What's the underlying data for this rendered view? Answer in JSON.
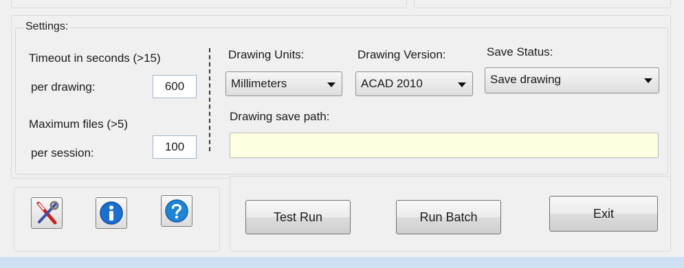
{
  "settings": {
    "group_title": "Settings:",
    "timeout_label": "Timeout in seconds (>15)",
    "per_drawing_label": "per drawing:",
    "timeout_value": "600",
    "max_files_label": "Maximum files (>5)",
    "per_session_label": "per session:",
    "max_files_value": "100",
    "units_label": "Drawing Units:",
    "units_value": "Millimeters",
    "version_label": "Drawing Version:",
    "version_value": "ACAD 2010",
    "save_status_label": "Save Status:",
    "save_status_value": "Save drawing",
    "save_path_label": "Drawing save path:",
    "save_path_value": ""
  },
  "toolbar": {
    "tools_icon": "tools-icon",
    "info_icon": "info-icon",
    "help_icon": "help-icon"
  },
  "actions": {
    "test_run": "Test Run",
    "run_batch": "Run Batch",
    "exit": "Exit"
  },
  "colors": {
    "path_field_bg": "#ffffe1",
    "info_blue": "#1a6fcf",
    "bottom_strip": "#cde0f3"
  }
}
